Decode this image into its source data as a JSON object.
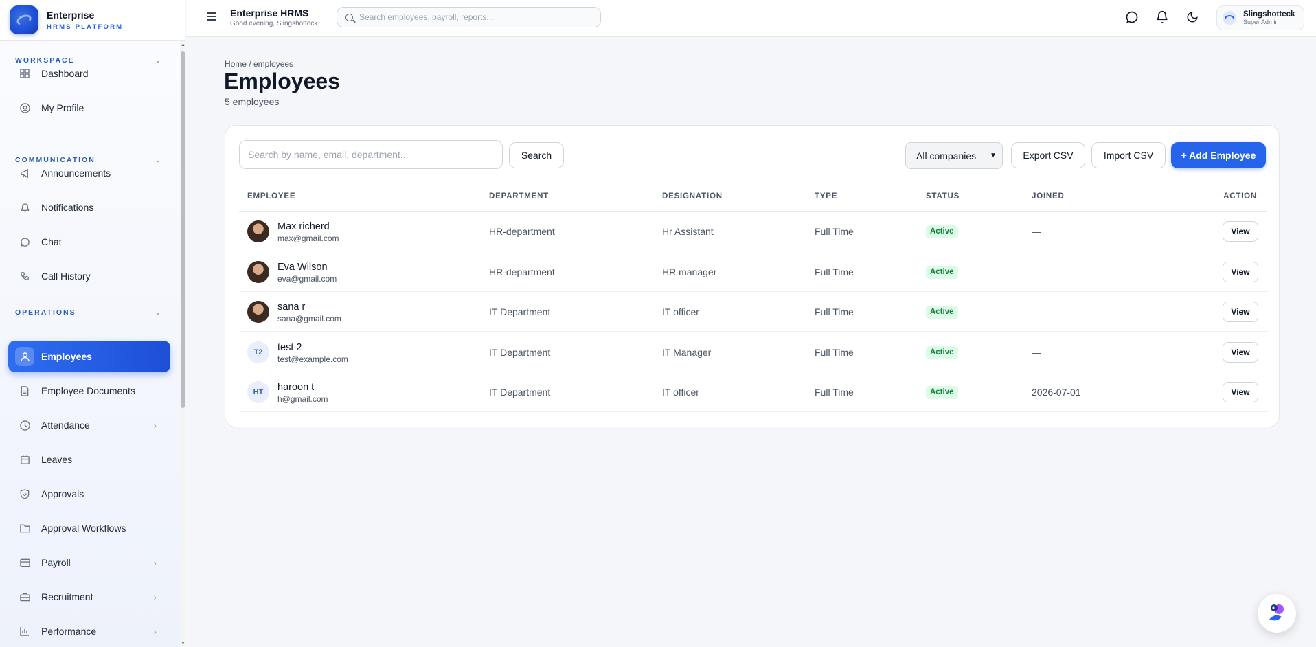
{
  "brand": {
    "name": "Enterprise",
    "sub": "HRMS PLATFORM"
  },
  "sidebar": {
    "sections": [
      {
        "label": "WORKSPACE"
      },
      {
        "label": "COMMUNICATION"
      },
      {
        "label": "OPERATIONS"
      }
    ],
    "items": [
      {
        "label": "Dashboard",
        "icon": "grid-icon"
      },
      {
        "label": "My Profile",
        "icon": "user-circle-icon"
      },
      {
        "label": "Announcements",
        "icon": "megaphone-icon"
      },
      {
        "label": "Notifications",
        "icon": "bell-icon"
      },
      {
        "label": "Chat",
        "icon": "chat-icon"
      },
      {
        "label": "Call History",
        "icon": "phone-icon"
      },
      {
        "label": "Employees",
        "icon": "users-icon",
        "active": true
      },
      {
        "label": "Employee Documents",
        "icon": "document-icon"
      },
      {
        "label": "Attendance",
        "icon": "clock-icon",
        "expandable": true
      },
      {
        "label": "Leaves",
        "icon": "calendar-icon"
      },
      {
        "label": "Approvals",
        "icon": "shield-check-icon"
      },
      {
        "label": "Approval Workflows",
        "icon": "folder-icon"
      },
      {
        "label": "Payroll",
        "icon": "wallet-icon",
        "expandable": true
      },
      {
        "label": "Recruitment",
        "icon": "briefcase-icon",
        "expandable": true
      },
      {
        "label": "Performance",
        "icon": "bar-chart-icon",
        "expandable": true
      }
    ]
  },
  "topbar": {
    "title": "Enterprise HRMS",
    "greeting": "Good evening, Slingshotteck",
    "search_placeholder": "Search employees, payroll, reports...",
    "user_name": "Slingshotteck",
    "user_role": "Super Admin"
  },
  "page": {
    "breadcrumb": "Home / employees",
    "title": "Employees",
    "count": "5 employees"
  },
  "toolbar": {
    "search_placeholder": "Search by name, email, department...",
    "search_label": "Search",
    "company_filter": "All companies",
    "export_label": "Export CSV",
    "import_label": "Import CSV",
    "add_label": "+ Add Employee"
  },
  "table": {
    "headers": [
      "EMPLOYEE",
      "DEPARTMENT",
      "DESIGNATION",
      "TYPE",
      "STATUS",
      "JOINED",
      "ACTION"
    ],
    "rows": [
      {
        "name": "Max richerd",
        "email": "max@gmail.com",
        "avatar": "photo",
        "initials": "",
        "department": "HR-department",
        "designation": "Hr Assistant",
        "type": "Full Time",
        "status": "Active",
        "joined": "—",
        "action": "View"
      },
      {
        "name": "Eva Wilson",
        "email": "eva@gmail.com",
        "avatar": "photo",
        "initials": "",
        "department": "HR-department",
        "designation": "HR manager",
        "type": "Full Time",
        "status": "Active",
        "joined": "—",
        "action": "View"
      },
      {
        "name": "sana r",
        "email": "sana@gmail.com",
        "avatar": "photo",
        "initials": "",
        "department": "IT Department",
        "designation": "IT officer",
        "type": "Full Time",
        "status": "Active",
        "joined": "—",
        "action": "View"
      },
      {
        "name": "test 2",
        "email": "test@example.com",
        "avatar": "initials",
        "initials": "T2",
        "department": "IT Department",
        "designation": "IT Manager",
        "type": "Full Time",
        "status": "Active",
        "joined": "—",
        "action": "View"
      },
      {
        "name": "haroon t",
        "email": "h@gmail.com",
        "avatar": "initials",
        "initials": "HT",
        "department": "IT Department",
        "designation": "IT officer",
        "type": "Full Time",
        "status": "Active",
        "joined": "2026-07-01",
        "action": "View"
      }
    ]
  },
  "colors": {
    "accent": "#2563eb",
    "status_active_bg": "#dcfce7",
    "status_active_text": "#15803d"
  }
}
